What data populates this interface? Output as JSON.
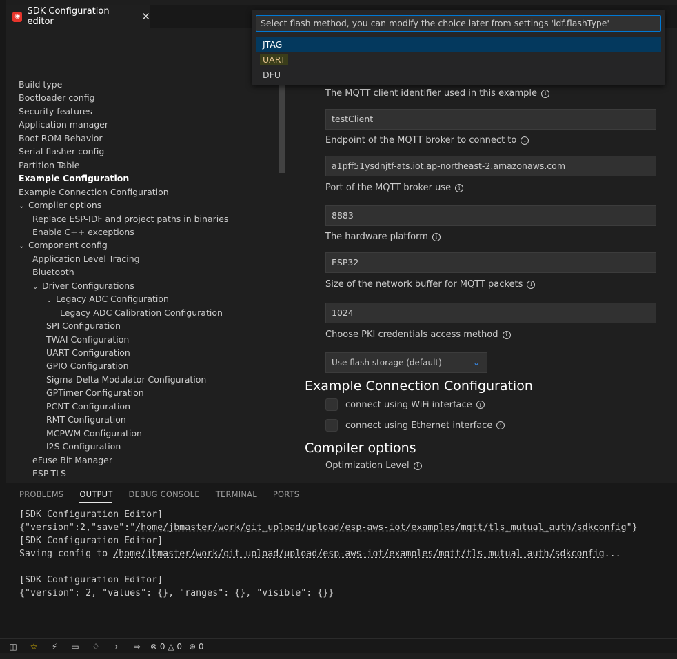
{
  "tab": {
    "title": "SDK Configuration editor",
    "close": "✕",
    "logo": "esp-icon"
  },
  "quickpick": {
    "placeholder": "Select flash method, you can modify the choice later from settings 'idf.flashType'",
    "items": [
      {
        "label": "JTAG",
        "selected": true
      },
      {
        "label": "UART",
        "highlighted": true
      },
      {
        "label": "DFU"
      }
    ]
  },
  "tree": {
    "items": [
      {
        "label": "Build type",
        "indent": 0
      },
      {
        "label": "Bootloader config",
        "indent": 0
      },
      {
        "label": "Security features",
        "indent": 0
      },
      {
        "label": "Application manager",
        "indent": 0
      },
      {
        "label": "Boot ROM Behavior",
        "indent": 0
      },
      {
        "label": "Serial flasher config",
        "indent": 0
      },
      {
        "label": "Partition Table",
        "indent": 0
      },
      {
        "label": "Example Configuration",
        "indent": 0,
        "bold": true
      },
      {
        "label": "Example Connection Configuration",
        "indent": 0
      },
      {
        "label": "Compiler options",
        "indent": 0,
        "chevron": true
      },
      {
        "label": "Replace ESP-IDF and project paths in binaries",
        "indent": 1
      },
      {
        "label": "Enable C++ exceptions",
        "indent": 1
      },
      {
        "label": "Component config",
        "indent": 0,
        "chevron": true
      },
      {
        "label": "Application Level Tracing",
        "indent": 1
      },
      {
        "label": "Bluetooth",
        "indent": 1
      },
      {
        "label": "Driver Configurations",
        "indent": 1,
        "chevron": true
      },
      {
        "label": "Legacy ADC Configuration",
        "indent": 2,
        "chevron": true
      },
      {
        "label": "Legacy ADC Calibration Configuration",
        "indent": 3
      },
      {
        "label": "SPI Configuration",
        "indent": 2
      },
      {
        "label": "TWAI Configuration",
        "indent": 2
      },
      {
        "label": "UART Configuration",
        "indent": 2
      },
      {
        "label": "GPIO Configuration",
        "indent": 2
      },
      {
        "label": "Sigma Delta Modulator Configuration",
        "indent": 2
      },
      {
        "label": "GPTimer Configuration",
        "indent": 2
      },
      {
        "label": "PCNT Configuration",
        "indent": 2
      },
      {
        "label": "RMT Configuration",
        "indent": 2
      },
      {
        "label": "MCPWM Configuration",
        "indent": 2
      },
      {
        "label": "I2S Configuration",
        "indent": 2
      },
      {
        "label": "eFuse Bit Manager",
        "indent": 1
      },
      {
        "label": "ESP-TLS",
        "indent": 1
      }
    ]
  },
  "panel": {
    "client_id_label": "The MQTT client identifier used in this example",
    "client_id_value": "testClient",
    "endpoint_label": "Endpoint of the MQTT broker to connect to",
    "endpoint_value": "a1pff51ysdnjtf-ats.iot.ap-northeast-2.amazonaws.com",
    "port_label": "Port of the MQTT broker use",
    "port_value": "8883",
    "platform_label": "The hardware platform",
    "platform_value": "ESP32",
    "buffer_label": "Size of the network buffer for MQTT packets",
    "buffer_value": "1024",
    "pki_label": "Choose PKI credentials access method",
    "pki_value": "Use flash storage (default)",
    "section_connection": "Example Connection Configuration",
    "wifi_label": "connect using WiFi interface",
    "ethernet_label": "connect using Ethernet interface",
    "section_compiler": "Compiler options",
    "optimization_label": "Optimization Level",
    "info_glyph": "i"
  },
  "bottom": {
    "tabs": [
      "PROBLEMS",
      "OUTPUT",
      "DEBUG CONSOLE",
      "TERMINAL",
      "PORTS"
    ],
    "active_tab": "OUTPUT",
    "output": {
      "l1": "[SDK Configuration Editor]",
      "l2_pre": "{\"version\":2,\"save\":\"",
      "l2_link": "/home/jbmaster/work/git_upload/upload/esp-aws-iot/examples/mqtt/tls_mutual_auth/sdkconfig",
      "l2_post": "\"}",
      "l3": "[SDK Configuration Editor]",
      "l4_pre": "Saving config to ",
      "l4_link": "/home/jbmaster/work/git_upload/upload/esp-aws-iot/examples/mqtt/tls_mutual_auth/sdkconfig",
      "l4_post": "...",
      "l5": "",
      "l6": "[SDK Configuration Editor]",
      "l7": "{\"version\": 2, \"values\": {}, \"ranges\": {}, \"visible\": {}}"
    }
  },
  "statusbar": {
    "errors": "0",
    "warnings": "0",
    "ports": "0"
  }
}
